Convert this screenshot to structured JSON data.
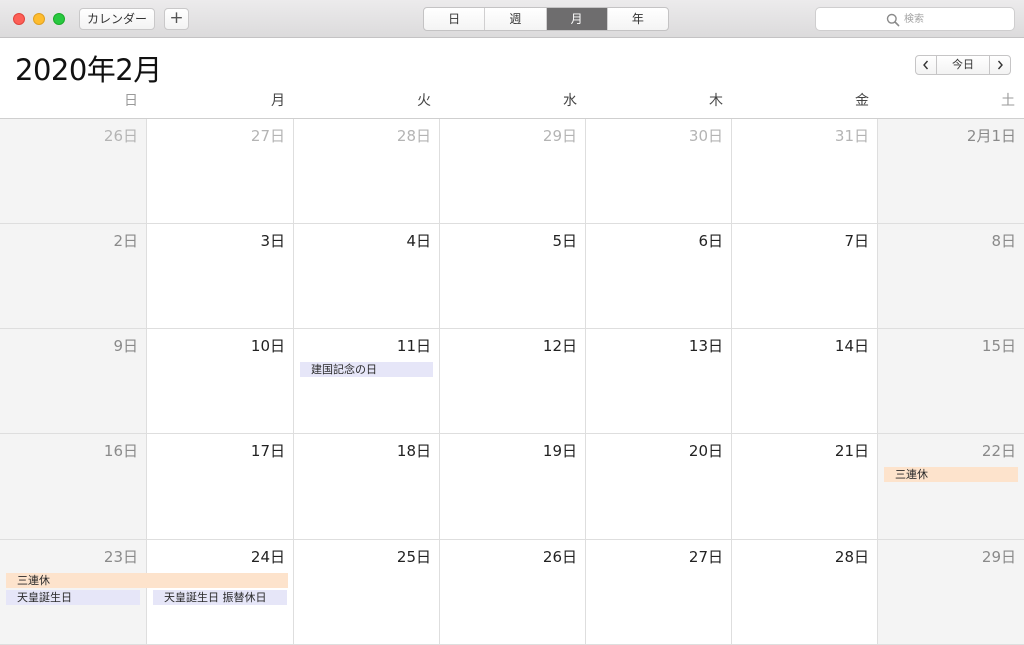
{
  "toolbar": {
    "calendars_label": "カレンダー",
    "add_label": "+",
    "view_tabs": [
      {
        "label": "日",
        "active": false
      },
      {
        "label": "週",
        "active": false
      },
      {
        "label": "月",
        "active": true
      },
      {
        "label": "年",
        "active": false
      }
    ],
    "search_placeholder": "検索"
  },
  "header": {
    "title": "2020年2月",
    "today_label": "今日"
  },
  "weekdays": [
    {
      "label": "日",
      "weekend": true
    },
    {
      "label": "月",
      "weekend": false
    },
    {
      "label": "火",
      "weekend": false
    },
    {
      "label": "水",
      "weekend": false
    },
    {
      "label": "木",
      "weekend": false
    },
    {
      "label": "金",
      "weekend": false
    },
    {
      "label": "土",
      "weekend": true
    }
  ],
  "weeks": [
    [
      {
        "label": "26日",
        "other": true
      },
      {
        "label": "27日",
        "other": true
      },
      {
        "label": "28日",
        "other": true
      },
      {
        "label": "29日",
        "other": true
      },
      {
        "label": "30日",
        "other": true
      },
      {
        "label": "31日",
        "other": true
      },
      {
        "label": "2月1日",
        "other": false
      }
    ],
    [
      {
        "label": "2日"
      },
      {
        "label": "3日"
      },
      {
        "label": "4日"
      },
      {
        "label": "5日"
      },
      {
        "label": "6日"
      },
      {
        "label": "7日"
      },
      {
        "label": "8日"
      }
    ],
    [
      {
        "label": "9日"
      },
      {
        "label": "10日"
      },
      {
        "label": "11日",
        "events": [
          {
            "title": "建国記念の日",
            "type": "holiday"
          }
        ]
      },
      {
        "label": "12日"
      },
      {
        "label": "13日"
      },
      {
        "label": "14日"
      },
      {
        "label": "15日"
      }
    ],
    [
      {
        "label": "16日"
      },
      {
        "label": "17日"
      },
      {
        "label": "18日"
      },
      {
        "label": "19日"
      },
      {
        "label": "20日"
      },
      {
        "label": "21日"
      },
      {
        "label": "22日",
        "events": [
          {
            "title": "三連休",
            "type": "orange"
          }
        ]
      }
    ],
    [
      {
        "label": "23日",
        "events": [
          {
            "title": "天皇誕生日",
            "type": "holiday"
          }
        ]
      },
      {
        "label": "24日",
        "events": [
          {
            "title": "天皇誕生日 振替休日",
            "type": "holiday"
          }
        ]
      },
      {
        "label": "25日"
      },
      {
        "label": "26日"
      },
      {
        "label": "27日"
      },
      {
        "label": "28日"
      },
      {
        "label": "29日"
      }
    ]
  ],
  "spanning_events": [
    {
      "title": "三連休",
      "type": "orange",
      "week": 4,
      "start_col": 0,
      "end_col": 1
    }
  ],
  "colors": {
    "holiday_event": "#e6e6f8",
    "three_day_weekend_event": "#fde3cc",
    "active_tab": "#6e6d6e"
  }
}
